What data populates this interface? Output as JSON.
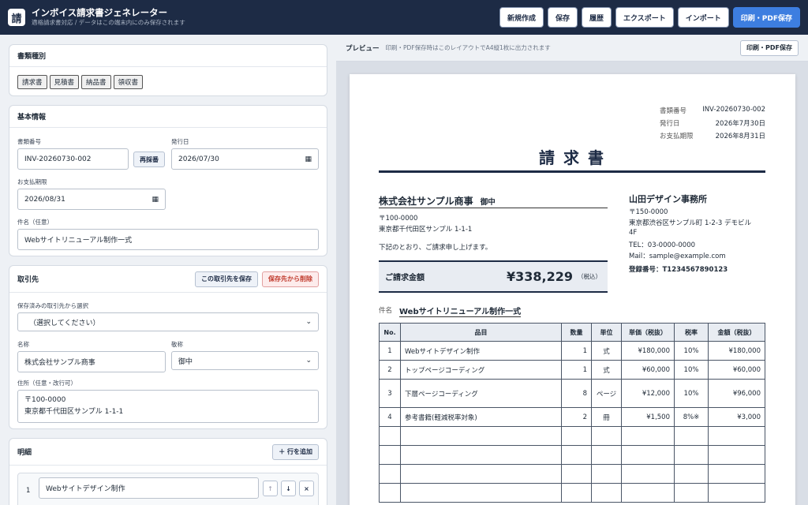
{
  "app": {
    "icon": "請",
    "title": "インボイス請求書ジェネレーター",
    "subtitle": "適格請求書対応 / データはこの端末内にのみ保存されます"
  },
  "toolbar": {
    "new": "新規作成",
    "save": "保存",
    "history": "履歴",
    "export": "エクスポート",
    "import": "インポート",
    "print": "印刷・PDF保存"
  },
  "doc_type": {
    "title": "書類種別",
    "options": [
      "請求書",
      "見積書",
      "納品書",
      "領収書"
    ]
  },
  "basic": {
    "title": "基本情報",
    "number_label": "書類番号",
    "number": "INV-20260730-002",
    "renumber": "再採番",
    "issue_label": "発行日",
    "issue_date": "2026/07/30",
    "due_label": "お支払期限",
    "due_date": "2026/08/31",
    "subject_label": "件名（任意）",
    "subject": "Webサイトリニューアル制作一式"
  },
  "client": {
    "title": "取引先",
    "save_btn": "この取引先を保存",
    "delete_btn": "保存先から削除",
    "select_label": "保存済みの取引先から選択",
    "select_value": "（選択してください）",
    "name_label": "名称",
    "name": "株式会社サンプル商事",
    "honorific_label": "敬称",
    "honorific": "御中",
    "address_label": "住所（任意・改行可）",
    "address1": "〒100-0000",
    "address2": "東京都千代田区サンプル 1-1-1"
  },
  "lines": {
    "title": "明細",
    "add_btn": "＋ 行を追加",
    "first_index": "1",
    "first_item": "Webサイトデザイン制作",
    "up": "↑",
    "down": "↓",
    "remove": "×"
  },
  "preview": {
    "label": "プレビュー",
    "note": "印刷・PDF保存時はこのレイアウトでA4縦1枚に出力されます",
    "print_btn": "印刷・PDF保存",
    "meta": {
      "num_label": "書類番号",
      "num": "INV-20260730-002",
      "issue_label": "発行日",
      "issue": "2026年7月30日",
      "due_label": "お支払期限",
      "due": "2026年8月31日"
    },
    "doc_title": "請 求 書",
    "to_name": "株式会社サンプル商事",
    "to_hon": "御中",
    "to_zip": "〒100-0000",
    "to_addr": "東京都千代田区サンプル 1-1-1",
    "greeting": "下記のとおり、ご請求申し上げます。",
    "amount_label": "ご請求金額",
    "amount": "¥338,229",
    "tax_note": "（税込）",
    "subject_label": "件名",
    "subject": "Webサイトリニューアル制作一式",
    "issuer": {
      "name": "山田デザイン事務所",
      "zip": "〒150-0000",
      "addr1": "東京都渋谷区サンプル町 1-2-3 デモビル",
      "addr2": "4F",
      "tel": "TEL：03-0000-0000",
      "mail": "Mail：sample@example.com",
      "reg": "登録番号：T1234567890123"
    },
    "table": {
      "headers": [
        "No.",
        "品目",
        "数量",
        "単位",
        "単価（税抜）",
        "税率",
        "金額（税抜）"
      ],
      "rows": [
        [
          "1",
          "Webサイトデザイン制作",
          "1",
          "式",
          "¥180,000",
          "10%",
          "¥180,000"
        ],
        [
          "2",
          "トップページコーディング",
          "1",
          "式",
          "¥60,000",
          "10%",
          "¥60,000"
        ],
        [
          "3",
          "下層ページコーディング",
          "8",
          "ページ",
          "¥12,000",
          "10%",
          "¥96,000"
        ],
        [
          "4",
          "参考書籍(軽減税率対象)",
          "2",
          "冊",
          "¥1,500",
          "8%※",
          "¥3,000"
        ]
      ]
    }
  }
}
